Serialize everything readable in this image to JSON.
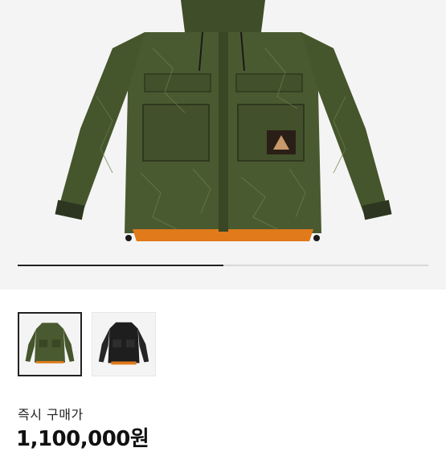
{
  "product": {
    "image_alt": "olive green quilted hooded jacket",
    "gallery_position": 0.5,
    "thumbnails": [
      {
        "color": "olive-green",
        "selected": true
      },
      {
        "color": "black",
        "selected": false
      }
    ]
  },
  "pricing": {
    "label": "즉시 구매가",
    "price": "1,100,000원"
  },
  "colors": {
    "olive": "#4a5a30",
    "olive_dark": "#3a4724",
    "black": "#1e1e1e",
    "lining_orange": "#e07a1a",
    "background": "#f4f4f4"
  }
}
